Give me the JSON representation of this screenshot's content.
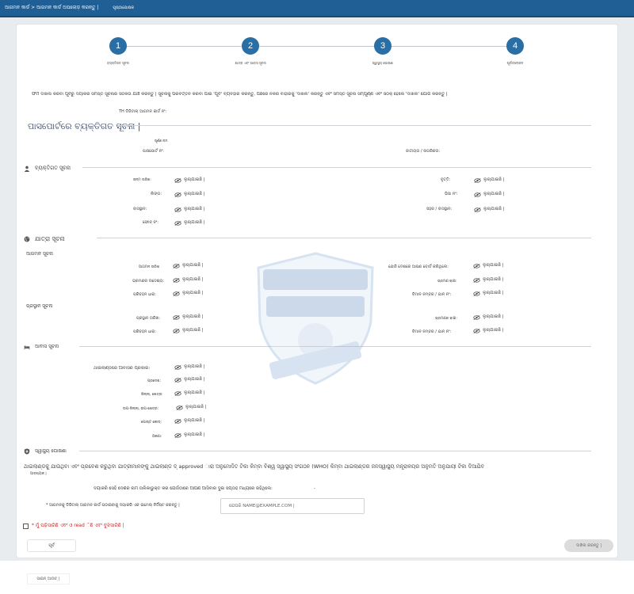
{
  "topbar": {
    "breadcrumb": "ଆଗମନ କାର୍ଡ > ଆଗମନ କାର୍ଡ ଅପଲୋଡ଼ କରନ୍ତୁ |",
    "link": "ପୃଷ୍ଠାପୋଷକ"
  },
  "steps": [
    {
      "num": "1",
      "label": "ବ୍ୟକ୍ତିଗତ ସୂଚନା"
    },
    {
      "num": "2",
      "label": "ଯାତ୍ରା ଏବଂ ଆବାସ ସୂଚନା"
    },
    {
      "num": "3",
      "label": "ସ୍ୱାସ୍ଥ୍ୟ ଘୋଷଣା"
    },
    {
      "num": "4",
      "label": "ପୂର୍ବାବଲୋକନ"
    }
  ],
  "instructions": "ଫର୍ମ ଦାଖଲ କରିବା ପୂର୍ବରୁ ଦୟାକରି ସମସ୍ତ ସୂଚନାର ସଠିକତା ଯାଞ୍ଚ କରନ୍ତୁ | ସୂଚନାକୁ ପରିବର୍ତ୍ତନ କରିବା ପାଇଁ 'ପୂର୍ବ' ବ୍ୟବହାର କରନ୍ତୁ, ପଛରେ ନକରି ବାହାରକୁ 'ଦାଖିଲ' କରନ୍ତୁ ଏବଂ ସମସ୍ତ ସୂଚନା ସମ୍ପୂର୍ଣ୍ଣ ଏବଂ ସଠିକ୍ ହେଲେ 'ଦାଖଲ' ଯୋଗ କରନ୍ତୁ |",
  "card_no_label": "TH ଡିଜିଟାଲ୍ ଆଗମନ କାର୍ଡ ନଂ:",
  "passport_title": "ପାସପୋର୍ଟରେ ବ୍ୟକ୍ତିଗତ ସୂଚନା |",
  "passport": {
    "full_name": "ପୂର୍ଣ୍ଣ ନାମ",
    "passport_no": "ପାସପୋର୍ଟ ନଂ:",
    "nationality": "ଜାତୀୟତା / ନାଗରିକତା:"
  },
  "masked": "ଲୁଚାଯାଇଛି |",
  "personal": {
    "title": "ବ୍ୟକ୍ତିଗତ ସୂଚନା",
    "dob": "ଜନ୍ମ ତାରିଖ:",
    "occupation": "ବୃତ୍ତି:",
    "gender": "ଲିଙ୍ଗ:",
    "visa": "ଭିସା ନଂ:",
    "residence": "ବାସସ୍ଥାନ:",
    "city": "ସହର / ବାସସ୍ଥାନ:",
    "phone": "ଫୋନ୍ ନଂ:"
  },
  "travel": {
    "title": "ଯାତ୍ରା ସୂଚନା",
    "arrival_title": "ଆଗମନ ସୂଚନା",
    "arrival_date": "ଆଗମନ ତାରିଖ",
    "boarding_country": "ଯେଉଁ ଦେଶରେ ଆପଣ ବୋର୍ଡ କରିଥିଲେ:",
    "travel_mode": "ଭ୍ରମଣର ଉଦ୍ଦେଶ୍ୟ:",
    "transport": "ଭ୍ରମଣ ଢାଞ୍ଚା:",
    "transport_mode": "ପରିବହନ ଧାରା:",
    "flight_no": "ବିମାନ ନମ୍ବର / ଯାନ ନଂ:",
    "departure_title": "ପ୍ରସ୍ଥାନ ସୂଚନା",
    "departure_date": "ପ୍ରସ୍ଥାନ ତାରିଖ:",
    "dep_travel_mode": "ଭ୍ରମଣର ଢାଞ୍ଚା:",
    "dep_transport_mode": "ପରିବହନ ଧାରା:",
    "dep_flight_no": "ବିମାନ ନମ୍ବର / ଯାନ ନଂ:"
  },
  "accommodation": {
    "title": "ଆବାସ ସୂଚନା",
    "type": "ଥାଇଲାଣ୍ଡରେ ଆବାସର ପ୍ରକାର:",
    "province": "ପ୍ରଦେଶ:",
    "district": "ଜିଲ୍ଲା, ଖେତ୍ର:",
    "subdistrict": "ଉପ-ଜିଲ୍ଲା, ଉପ-ଖେତ୍ର:",
    "postcode": "ପୋଷ୍ଟ କୋଡ୍:",
    "address": "ଠିକଣା:"
  },
  "health": {
    "title": "ସ୍ୱାସ୍ଥ୍ୟ ଘୋଷଣା",
    "declaration": "ଥାଇଲାଣ୍ଡକୁ ଯାଉଥିବା ଏବଂ ପ୍ରବେଶ କରୁଥିବା ଯାତ୍ରୀମାନଙ୍କୁ ଥାଇଲାଣ୍ଡ ଦ୍ approved ାରା ଅନୁମୋଦିତ ଟିକା କିମ୍ବା ବିଶ୍ୱ ସ୍ୱାସ୍ଥ୍ୟ ସଂଗଠନ (WHO) କିମ୍ବା ଥାଇଲାଣ୍ଡର ଜନସ୍ୱାସ୍ଥ୍ୟ ମନ୍ତ୍ରାଳୟର ଅନୁମତି ଅନୁଯାୟୀ ଟିକା ଦିଆଯିବ",
    "declaration_tail": "ଆବଶ୍ୟକ |",
    "countries": "ଦୟାକରି ସେହି ଦେଶର ନାମ ତାଲିକାଭୁକ୍ତ କର ଯେଉଁଠାରେ ଆପଣ ଆସିବାର ଦୁଇ ସପ୍ତାହ ମଧ୍ୟରେ ରହିଥିଲେ:",
    "countries_value": "-",
    "email_label": "* ଆଗମନକୁ ଡିଜିଟାଲ୍ ଆଗମନ କାର୍ଡ ପଠାଇବାକୁ ଦୟାକରି ଏକ ଇମେଲ୍ ନିର୍ଦ୍ଦିଷ୍ଟ କରନ୍ତୁ |",
    "email_placeholder": "ଯେପରି NAME@EXAMPLE.COM |",
    "consent": "* ମୁଁ ପଢ଼ିସାରିଛି ଏବଂ ଓ read ିଛି ଏବଂ ବୁଝିସାରିଛି |"
  },
  "buttons": {
    "prev": "ପୂର୍ବ",
    "next": "ଦାଖିଲ କରନ୍ତୁ |",
    "save": "ସାଇନ୍ ଆଉଟ୍ |"
  },
  "colors": {
    "primary": "#1f5f95",
    "step": "#2a6ea6",
    "alert": "#d02222"
  }
}
